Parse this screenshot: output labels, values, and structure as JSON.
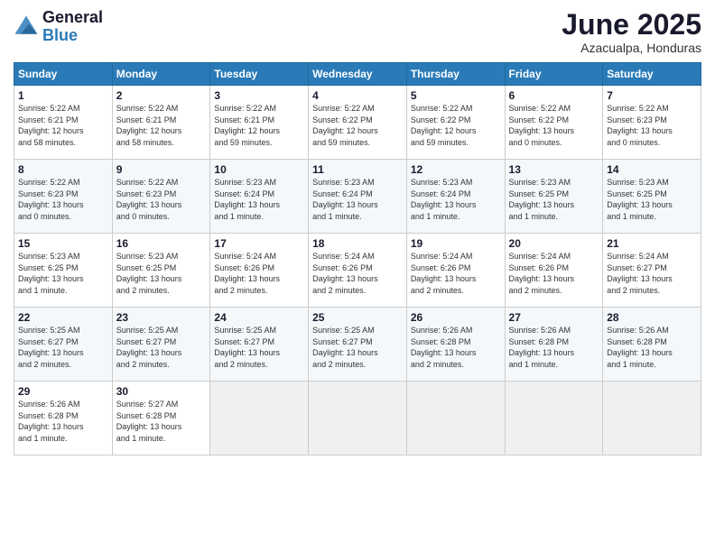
{
  "header": {
    "logo_general": "General",
    "logo_blue": "Blue",
    "month_title": "June 2025",
    "location": "Azacualpa, Honduras"
  },
  "weekdays": [
    "Sunday",
    "Monday",
    "Tuesday",
    "Wednesday",
    "Thursday",
    "Friday",
    "Saturday"
  ],
  "weeks": [
    [
      {
        "day": "1",
        "info": "Sunrise: 5:22 AM\nSunset: 6:21 PM\nDaylight: 12 hours\nand 58 minutes."
      },
      {
        "day": "2",
        "info": "Sunrise: 5:22 AM\nSunset: 6:21 PM\nDaylight: 12 hours\nand 58 minutes."
      },
      {
        "day": "3",
        "info": "Sunrise: 5:22 AM\nSunset: 6:21 PM\nDaylight: 12 hours\nand 59 minutes."
      },
      {
        "day": "4",
        "info": "Sunrise: 5:22 AM\nSunset: 6:22 PM\nDaylight: 12 hours\nand 59 minutes."
      },
      {
        "day": "5",
        "info": "Sunrise: 5:22 AM\nSunset: 6:22 PM\nDaylight: 12 hours\nand 59 minutes."
      },
      {
        "day": "6",
        "info": "Sunrise: 5:22 AM\nSunset: 6:22 PM\nDaylight: 13 hours\nand 0 minutes."
      },
      {
        "day": "7",
        "info": "Sunrise: 5:22 AM\nSunset: 6:23 PM\nDaylight: 13 hours\nand 0 minutes."
      }
    ],
    [
      {
        "day": "8",
        "info": "Sunrise: 5:22 AM\nSunset: 6:23 PM\nDaylight: 13 hours\nand 0 minutes."
      },
      {
        "day": "9",
        "info": "Sunrise: 5:22 AM\nSunset: 6:23 PM\nDaylight: 13 hours\nand 0 minutes."
      },
      {
        "day": "10",
        "info": "Sunrise: 5:23 AM\nSunset: 6:24 PM\nDaylight: 13 hours\nand 1 minute."
      },
      {
        "day": "11",
        "info": "Sunrise: 5:23 AM\nSunset: 6:24 PM\nDaylight: 13 hours\nand 1 minute."
      },
      {
        "day": "12",
        "info": "Sunrise: 5:23 AM\nSunset: 6:24 PM\nDaylight: 13 hours\nand 1 minute."
      },
      {
        "day": "13",
        "info": "Sunrise: 5:23 AM\nSunset: 6:25 PM\nDaylight: 13 hours\nand 1 minute."
      },
      {
        "day": "14",
        "info": "Sunrise: 5:23 AM\nSunset: 6:25 PM\nDaylight: 13 hours\nand 1 minute."
      }
    ],
    [
      {
        "day": "15",
        "info": "Sunrise: 5:23 AM\nSunset: 6:25 PM\nDaylight: 13 hours\nand 1 minute."
      },
      {
        "day": "16",
        "info": "Sunrise: 5:23 AM\nSunset: 6:25 PM\nDaylight: 13 hours\nand 2 minutes."
      },
      {
        "day": "17",
        "info": "Sunrise: 5:24 AM\nSunset: 6:26 PM\nDaylight: 13 hours\nand 2 minutes."
      },
      {
        "day": "18",
        "info": "Sunrise: 5:24 AM\nSunset: 6:26 PM\nDaylight: 13 hours\nand 2 minutes."
      },
      {
        "day": "19",
        "info": "Sunrise: 5:24 AM\nSunset: 6:26 PM\nDaylight: 13 hours\nand 2 minutes."
      },
      {
        "day": "20",
        "info": "Sunrise: 5:24 AM\nSunset: 6:26 PM\nDaylight: 13 hours\nand 2 minutes."
      },
      {
        "day": "21",
        "info": "Sunrise: 5:24 AM\nSunset: 6:27 PM\nDaylight: 13 hours\nand 2 minutes."
      }
    ],
    [
      {
        "day": "22",
        "info": "Sunrise: 5:25 AM\nSunset: 6:27 PM\nDaylight: 13 hours\nand 2 minutes."
      },
      {
        "day": "23",
        "info": "Sunrise: 5:25 AM\nSunset: 6:27 PM\nDaylight: 13 hours\nand 2 minutes."
      },
      {
        "day": "24",
        "info": "Sunrise: 5:25 AM\nSunset: 6:27 PM\nDaylight: 13 hours\nand 2 minutes."
      },
      {
        "day": "25",
        "info": "Sunrise: 5:25 AM\nSunset: 6:27 PM\nDaylight: 13 hours\nand 2 minutes."
      },
      {
        "day": "26",
        "info": "Sunrise: 5:26 AM\nSunset: 6:28 PM\nDaylight: 13 hours\nand 2 minutes."
      },
      {
        "day": "27",
        "info": "Sunrise: 5:26 AM\nSunset: 6:28 PM\nDaylight: 13 hours\nand 1 minute."
      },
      {
        "day": "28",
        "info": "Sunrise: 5:26 AM\nSunset: 6:28 PM\nDaylight: 13 hours\nand 1 minute."
      }
    ],
    [
      {
        "day": "29",
        "info": "Sunrise: 5:26 AM\nSunset: 6:28 PM\nDaylight: 13 hours\nand 1 minute."
      },
      {
        "day": "30",
        "info": "Sunrise: 5:27 AM\nSunset: 6:28 PM\nDaylight: 13 hours\nand 1 minute."
      },
      {
        "day": "",
        "info": ""
      },
      {
        "day": "",
        "info": ""
      },
      {
        "day": "",
        "info": ""
      },
      {
        "day": "",
        "info": ""
      },
      {
        "day": "",
        "info": ""
      }
    ]
  ]
}
